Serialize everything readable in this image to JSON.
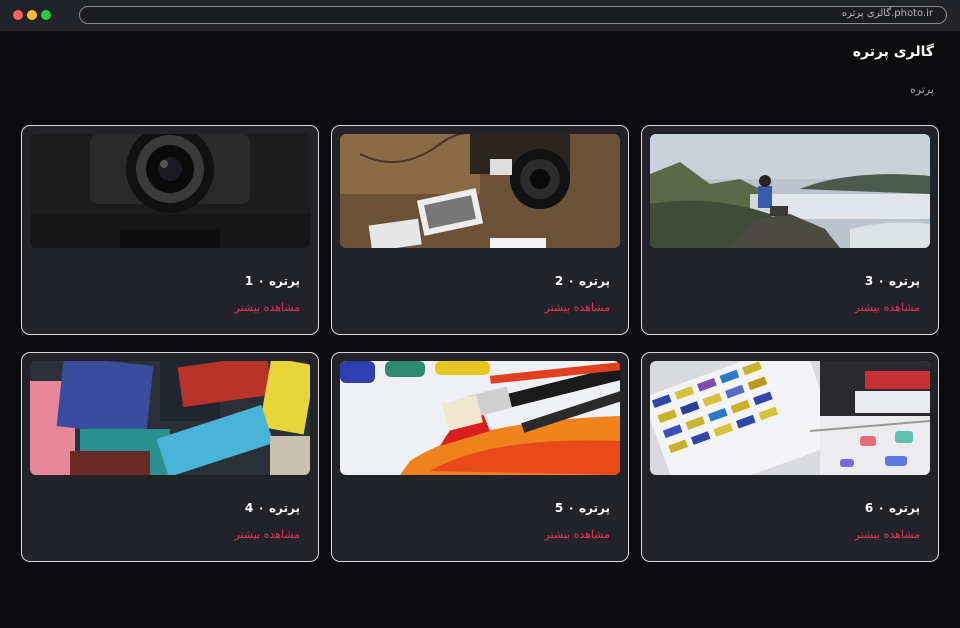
{
  "browser": {
    "url": "گالری پرتره.photo.ir"
  },
  "page": {
    "title": "گالری پرتره",
    "breadcrumb": "پرتره"
  },
  "cards": [
    {
      "title": "پرتره ۰ 1",
      "link_label": "مشاهده بیشتر",
      "image": "camera-closeup"
    },
    {
      "title": "پرتره ۰ 2",
      "link_label": "مشاهده بیشتر",
      "image": "camera-on-map-with-photos"
    },
    {
      "title": "پرتره ۰ 3",
      "link_label": "مشاهده بیشتر",
      "image": "photographer-on-mountain"
    },
    {
      "title": "پرتره ۰ 4",
      "link_label": "مشاهده بیشتر",
      "image": "paint-brushes"
    },
    {
      "title": "پرتره ۰ 5",
      "link_label": "مشاهده بیشتر",
      "image": "brushes-with-paint"
    },
    {
      "title": "پرتره ۰ 6",
      "link_label": "مشاهده بیشتر",
      "image": "color-swatches"
    }
  ],
  "colors": {
    "background": "#0c0c0e",
    "card": "#222229",
    "accent": "#e0365a"
  }
}
